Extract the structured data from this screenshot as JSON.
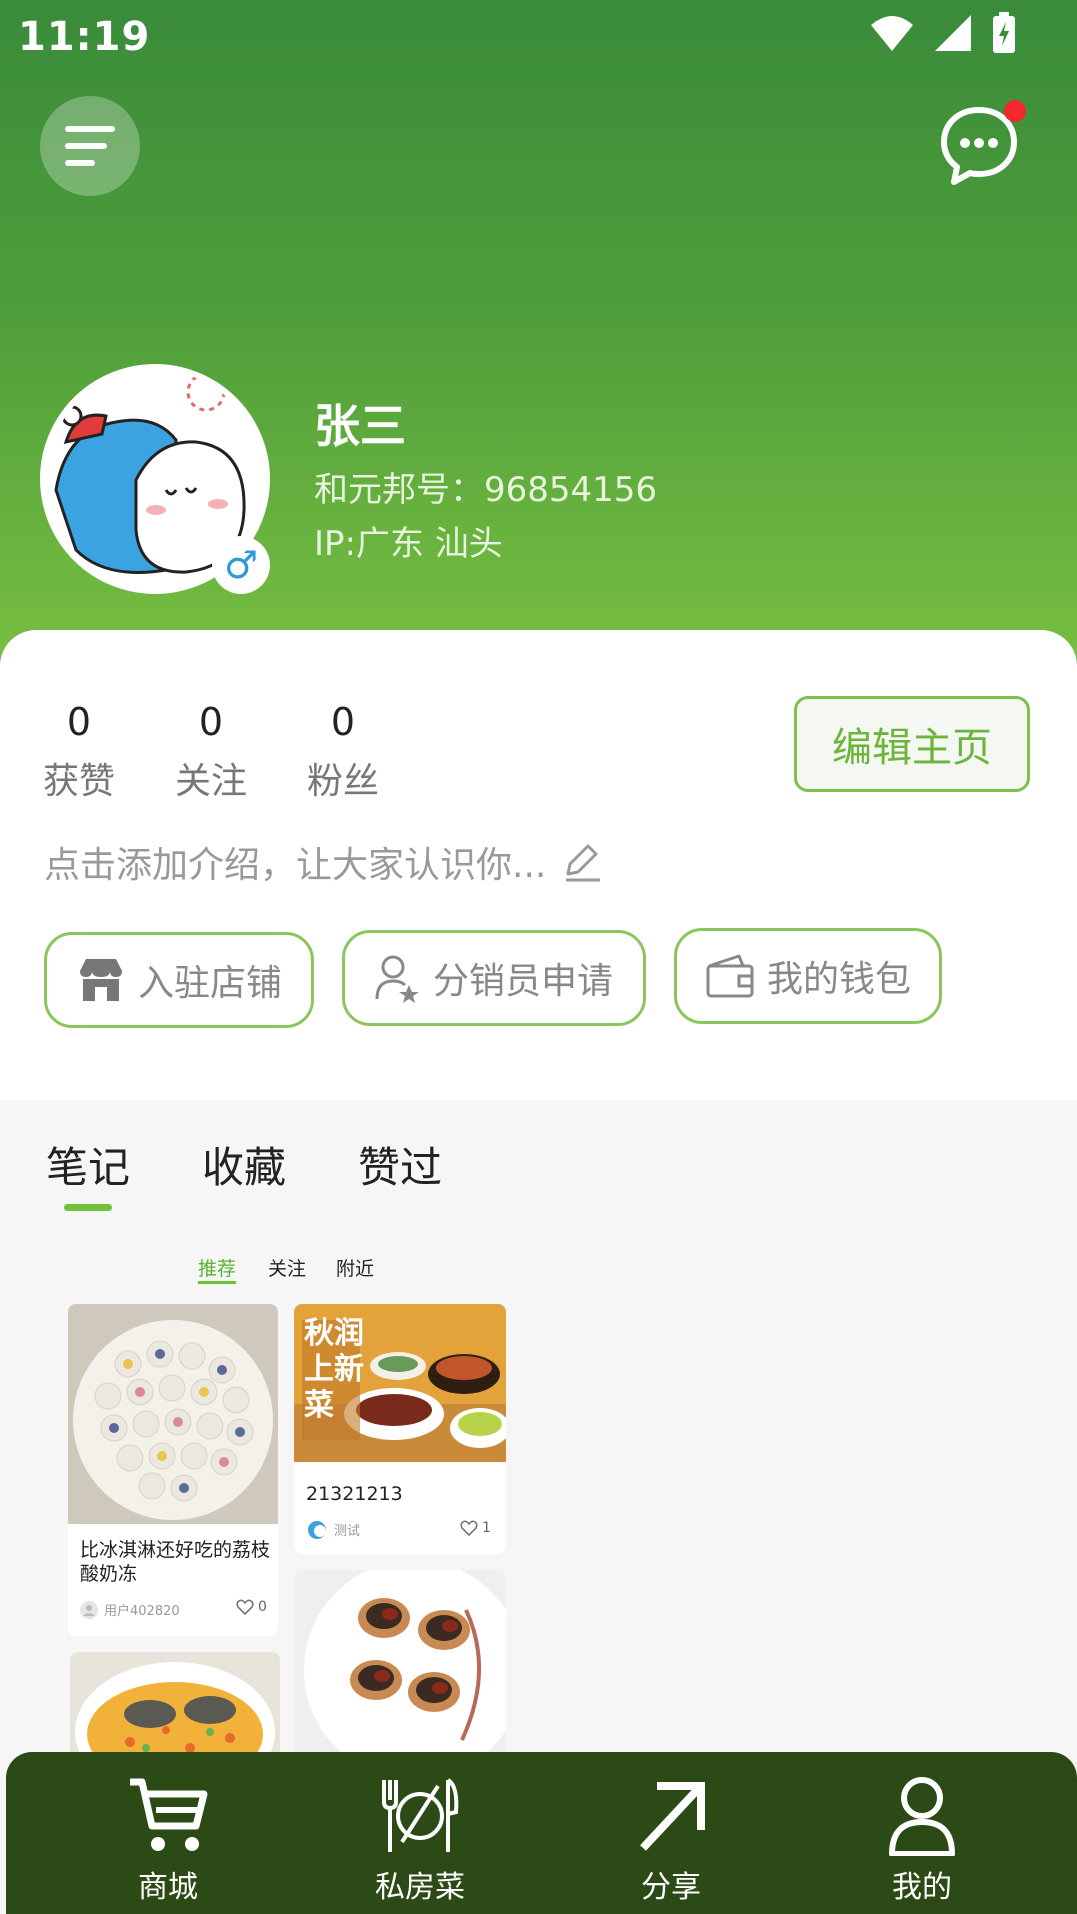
{
  "status_bar": {
    "time": "11:19"
  },
  "profile": {
    "name": "张三",
    "id_line": "和元邦号：96854156",
    "ip_line": "IP:广东 汕头",
    "gender_symbol": "♂"
  },
  "stats": [
    {
      "value": "0",
      "label": "获赞"
    },
    {
      "value": "0",
      "label": "关注"
    },
    {
      "value": "0",
      "label": "粉丝"
    }
  ],
  "edit_button": "编辑主页",
  "intro_text": "点击添加介绍，让大家认识你...",
  "actions": [
    {
      "label": "入驻店铺",
      "icon": "store-icon"
    },
    {
      "label": "分销员申请",
      "icon": "user-star-icon"
    },
    {
      "label": "我的钱包",
      "icon": "wallet-icon"
    }
  ],
  "tabs": [
    {
      "label": "笔记",
      "active": true
    },
    {
      "label": "收藏",
      "active": false
    },
    {
      "label": "赞过",
      "active": false
    }
  ],
  "subtabs": [
    {
      "label": "推荐",
      "active": true
    },
    {
      "label": "关注",
      "active": false
    },
    {
      "label": "附近",
      "active": false
    }
  ],
  "feed": [
    {
      "title": "比冰淇淋还好吃的荔枝酸奶冻",
      "author": "用户402820",
      "likes": "0"
    },
    {
      "title": "21321213",
      "author": "测试",
      "likes": "1",
      "image_text": "秋润上新菜"
    }
  ],
  "nav": [
    {
      "label": "商城",
      "icon": "cart-icon"
    },
    {
      "label": "私房菜",
      "icon": "dining-icon"
    },
    {
      "label": "分享",
      "icon": "share-arrow-icon"
    },
    {
      "label": "我的",
      "icon": "person-icon"
    }
  ],
  "colors": {
    "accent_green": "#6fc23a",
    "header_dark": "#3a8b3a",
    "nav_bg": "#2c4a16",
    "notification": "#f4262e"
  }
}
